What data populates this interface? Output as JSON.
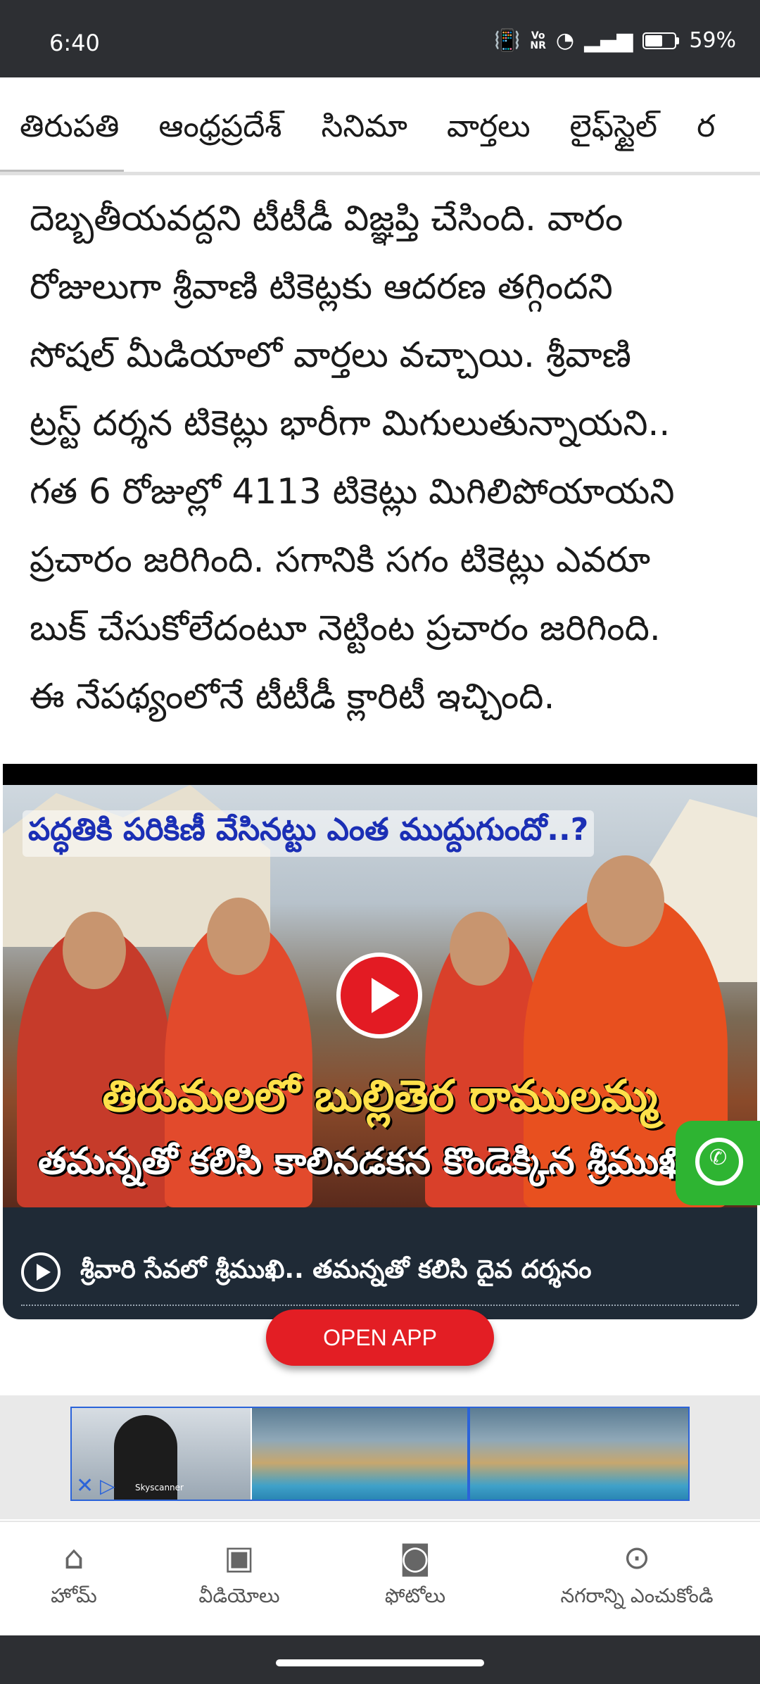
{
  "status_bar": {
    "time": "6:40",
    "network_label": "Vo\nNR",
    "battery_percent": "59%",
    "battery_level": 0.59
  },
  "tabs": {
    "items": [
      "తిరుపతి",
      "ఆంధ్రప్రదేశ్",
      "సినిమా",
      "వార్తలు",
      "లైఫ్‌స్టైల్",
      "ర"
    ],
    "selected_index": 0
  },
  "article": {
    "lines": [
      "దెబ్బతీయవద్దని టీటీడీ విజ్ఞప్తి చేసింది. వారం",
      "రోజులుగా శ్రీవాణి టికెట్లకు ఆదరణ తగ్గిందని",
      "సోషల్ మీడియాలో వార్తలు వచ్చాయి. శ్రీవాణి",
      "ట్రస్ట్ దర్శన టికెట్లు భారీగా మిగులుతున్నాయని..",
      "గత 6 రోజుల్లో 4113 టికెట్లు మిగిలిపోయాయని",
      "ప్రచారం జరిగింది. సగానికి సగం టికెట్లు ఎవరూ",
      "బుక్ చేసుకోలేదంటూ నెట్టింట ప్రచారం జరిగింది.",
      "ఈ నేపథ్యంలోనే టీటీడీ క్లారిటీ ఇచ్చింది."
    ]
  },
  "video": {
    "thumbnail_headline": "పద్ధతికి పరికిణీ వేసినట్టు ఎంత ముద్దుగుందో..?",
    "thumbnail_title_1": "తిరుమలలో బుల్లితెర రాములమ్మ",
    "thumbnail_title_2": "తమన్నతో కలిసి కాలినడకన కొండెక్కిన శ్రీముఖి",
    "caption": "శ్రీవారి సేవలో శ్రీముఖి.. తమన్నతో కలిసి దైవ దర్శనం"
  },
  "open_app_label": "OPEN APP",
  "ad": {
    "close_glyph": "✕",
    "choices_glyph": "▷",
    "brand": "Skyscanner"
  },
  "bottom_nav": {
    "home": "హోమ్",
    "videos": "వీడియోలు",
    "photos": "ఫోటోలు",
    "city": "నగరాన్ని ఎంచుకోండి"
  },
  "colors": {
    "status_bar_bg": "#2d2f33",
    "accent_red": "#e31e24",
    "video_bg": "#1f2a36",
    "whatsapp_green": "#2eb432"
  }
}
